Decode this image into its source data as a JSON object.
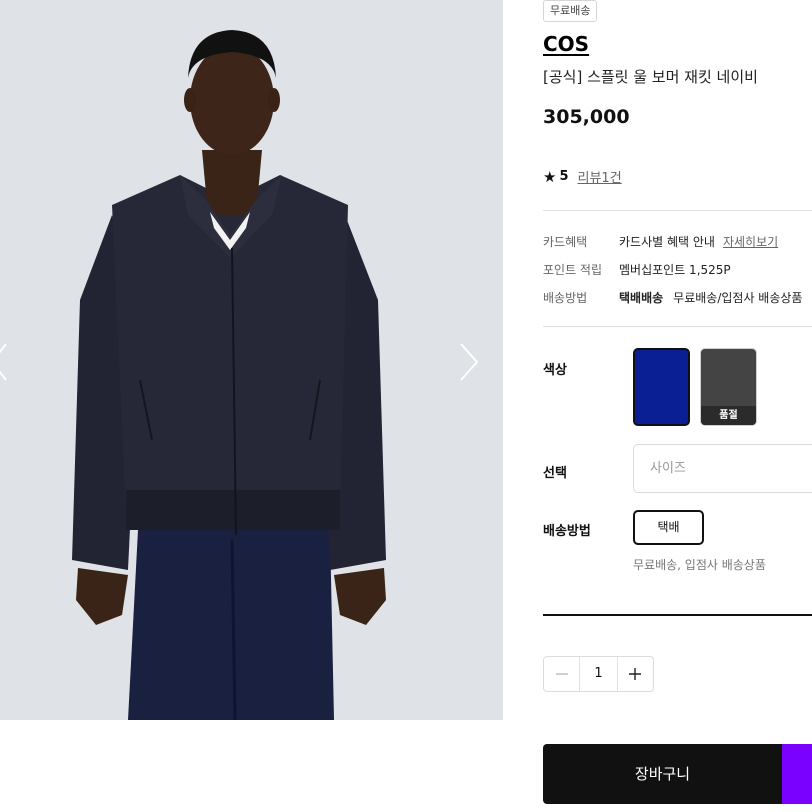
{
  "product": {
    "badge": "무료배송",
    "brand": "COS",
    "name": "[공식] 스플릿 울 보머 재킷 네이비",
    "price": "305,000"
  },
  "rating": {
    "score": "5",
    "reviews_link": "리뷰1건"
  },
  "benefits": {
    "card_label": "카드혜택",
    "card_value": "카드사별 혜택 안내",
    "card_link": "자세히보기",
    "point_label": "포인트 적립",
    "point_value": "멤버십포인트 1,525P",
    "delivery_label": "배송방법",
    "delivery_type": "택배배송",
    "delivery_value": "무료배송/입점사 배송상품"
  },
  "options": {
    "color_label": "색상",
    "colors": [
      {
        "name": "navy",
        "hex": "#0b1f94",
        "selected": true
      },
      {
        "name": "grey",
        "hex": "#444444",
        "soldout_label": "품절"
      }
    ],
    "select_label": "선택",
    "size_placeholder": "사이즈",
    "shipping_label": "배송방법",
    "shipping_option": "택배",
    "shipping_note": "무료배송, 입점사 배송상품"
  },
  "quantity": {
    "value": "1"
  },
  "actions": {
    "cart_label": "장바구니"
  },
  "colors": {
    "accent_purple": "#7a00ff",
    "primary_dark": "#111111"
  }
}
